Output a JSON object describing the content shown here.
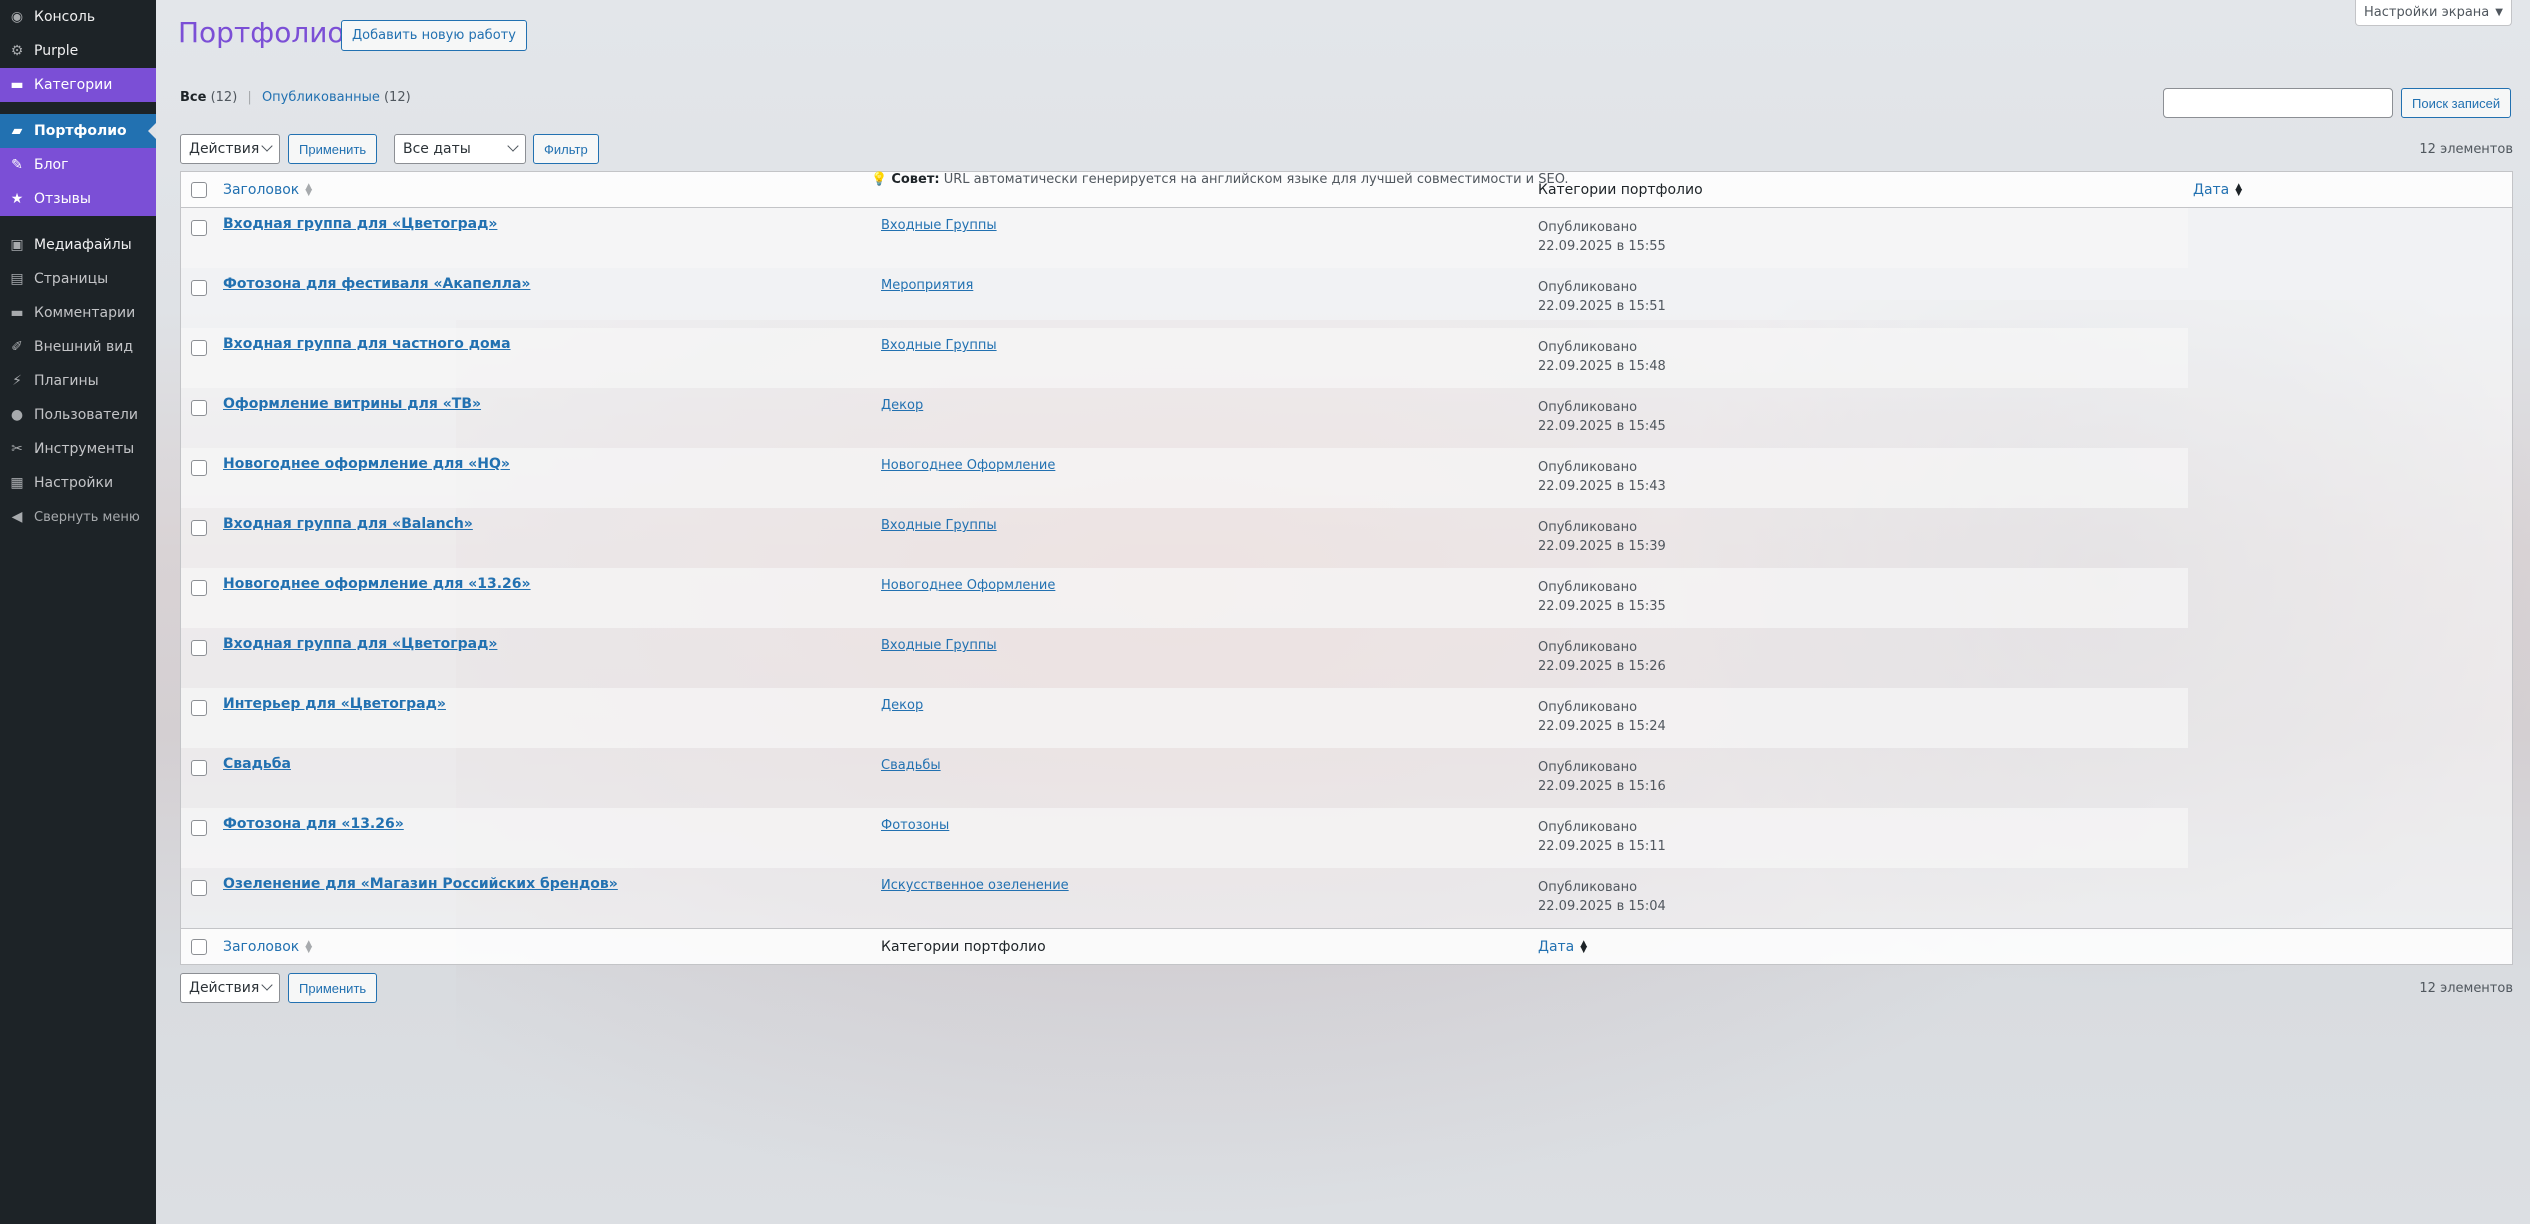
{
  "sidebar": {
    "items": [
      {
        "label": "Консоль",
        "icon": "dashboard-icon",
        "style": "normal"
      },
      {
        "label": "Purple",
        "icon": "gear-icon",
        "style": "normal"
      },
      {
        "label": "Категории",
        "icon": "folder-icon",
        "style": "purple"
      },
      {
        "label": "Портфолио",
        "icon": "folder-open-icon",
        "style": "current"
      },
      {
        "label": "Блог",
        "icon": "edit-icon",
        "style": "purple"
      },
      {
        "label": "Отзывы",
        "icon": "star-icon",
        "style": "purple"
      },
      {
        "label": "Медиафайлы",
        "icon": "media-icon",
        "style": "normal"
      },
      {
        "label": "Страницы",
        "icon": "page-icon",
        "style": "dim"
      },
      {
        "label": "Комментарии",
        "icon": "comment-icon",
        "style": "dim"
      },
      {
        "label": "Внешний вид",
        "icon": "brush-icon",
        "style": "dim"
      },
      {
        "label": "Плагины",
        "icon": "plugin-icon",
        "style": "dim"
      },
      {
        "label": "Пользователи",
        "icon": "user-icon",
        "style": "dim"
      },
      {
        "label": "Инструменты",
        "icon": "wrench-icon",
        "style": "dim"
      },
      {
        "label": "Настройки",
        "icon": "settings-icon",
        "style": "dim"
      },
      {
        "label": "Свернуть меню",
        "icon": "collapse-icon",
        "style": "collapse"
      }
    ]
  },
  "header": {
    "title": "Портфолио",
    "add_new": "Добавить новую работу",
    "screen_options": "Настройки экрана"
  },
  "filters": {
    "all_label": "Все",
    "all_count": "(12)",
    "published_label": "Опубликованные",
    "published_count": "(12)"
  },
  "search": {
    "button": "Поиск записей",
    "value": ""
  },
  "tablenav": {
    "bulk_actions": "Действия",
    "apply": "Применить",
    "dates": "Все даты",
    "filter": "Фильтр",
    "count": "12 элементов"
  },
  "table": {
    "columns": {
      "title": "Заголовок",
      "categories": "Категории портфолио",
      "date": "Дата"
    },
    "seo_tip_label": "Совет:",
    "seo_tip_text": " URL автоматически генерируется на английском языке для лучшей совместимости и SEO.",
    "rows": [
      {
        "title": "Входная группа для «Цветоград»",
        "category": "Входные Группы",
        "status": "Опубликовано",
        "date": "22.09.2025 в 15:55"
      },
      {
        "title": "Фотозона для фестиваля «Акапелла»",
        "category": "Мероприятия",
        "status": "Опубликовано",
        "date": "22.09.2025 в 15:51"
      },
      {
        "title": "Входная группа для частного дома",
        "category": "Входные Группы",
        "status": "Опубликовано",
        "date": "22.09.2025 в 15:48"
      },
      {
        "title": "Оформление витрины для «ТВ»",
        "category": "Декор",
        "status": "Опубликовано",
        "date": "22.09.2025 в 15:45"
      },
      {
        "title": "Новогоднее оформление для «HQ»",
        "category": "Новогоднее Оформление",
        "status": "Опубликовано",
        "date": "22.09.2025 в 15:43"
      },
      {
        "title": "Входная группа для «Balanch»",
        "category": "Входные Группы",
        "status": "Опубликовано",
        "date": "22.09.2025 в 15:39"
      },
      {
        "title": "Новогоднее оформление для «13.26»",
        "category": "Новогоднее Оформление",
        "status": "Опубликовано",
        "date": "22.09.2025 в 15:35"
      },
      {
        "title": "Входная группа для «Цветоград»",
        "category": "Входные Группы",
        "status": "Опубликовано",
        "date": "22.09.2025 в 15:26"
      },
      {
        "title": "Интерьер для «Цветоград»",
        "category": "Декор",
        "status": "Опубликовано",
        "date": "22.09.2025 в 15:24"
      },
      {
        "title": "Свадьба",
        "category": "Свадьбы",
        "status": "Опубликовано",
        "date": "22.09.2025 в 15:16"
      },
      {
        "title": "Фотозона для «13.26»",
        "category": "Фотозоны",
        "status": "Опубликовано",
        "date": "22.09.2025 в 15:11"
      },
      {
        "title": "Озеленение для «Магазин Российских брендов»",
        "category": "Искусственное озеленение",
        "status": "Опубликовано",
        "date": "22.09.2025 в 15:04"
      }
    ]
  },
  "colors": {
    "accent_purple": "#7b4fd6",
    "link_blue": "#2271b1",
    "current_blue": "#2271b1",
    "sidebar_bg": "#1d2327"
  }
}
